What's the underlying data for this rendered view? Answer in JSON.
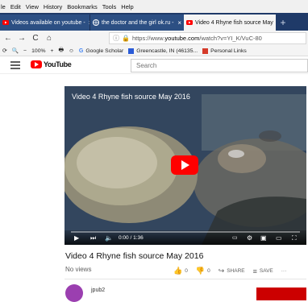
{
  "menu": [
    "le",
    "Edit",
    "View",
    "History",
    "Bookmarks",
    "Tools",
    "Help"
  ],
  "tabs": [
    {
      "title": "Videos available on youtube -",
      "close": "×"
    },
    {
      "title": "the doctor and the girl ok.ru -",
      "close": "×"
    },
    {
      "title": "Video 4 Rhyne fish source May",
      "close": "×"
    }
  ],
  "new_tab": "+",
  "nav": {
    "back": "←",
    "forward": "→",
    "reload": "C",
    "home": "⌂"
  },
  "url": {
    "prefix": "https://www.",
    "domain": "youtube.com",
    "path": "/watch?v=YI_K/VuC-80"
  },
  "toolbar": {
    "zoom_out": "−",
    "zoom": "100%",
    "zoom_in": "+"
  },
  "bookmarks": [
    {
      "label": "Google Scholar",
      "icon": "google-icon"
    },
    {
      "label": "Greencastle, IN (46135...",
      "icon": "weather-icon"
    },
    {
      "label": "Personal Links",
      "icon": "folder-icon"
    }
  ],
  "youtube": {
    "wordmark": "YouTube",
    "search_placeholder": "Search"
  },
  "video": {
    "overlay_title": "Video 4 Rhyne fish source May 2016",
    "time": "0:00 / 1:36",
    "progress": 0.0
  },
  "below": {
    "title": "Video 4 Rhyne fish source May 2016",
    "views": "No views",
    "likes": "0",
    "dislikes": "0",
    "share": "SHARE",
    "save": "SAVE",
    "more": "···",
    "channel": "jpub2"
  },
  "colors": {
    "youtube_red": "#ff0000",
    "tab_strip": "#1f3a68"
  }
}
